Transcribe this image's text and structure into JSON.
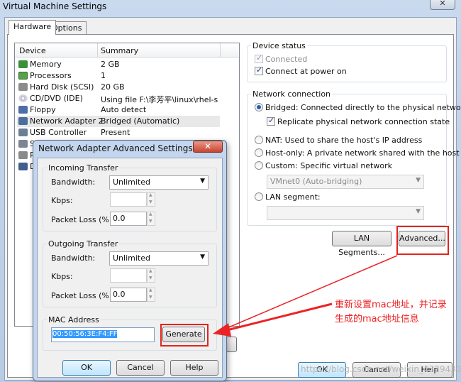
{
  "window": {
    "title": "Virtual Machine Settings",
    "close_glyph": "✕",
    "tabs": [
      {
        "label": "Hardware"
      },
      {
        "label": "Options"
      }
    ]
  },
  "devices": {
    "headers": {
      "device": "Device",
      "summary": "Summary"
    },
    "rows": [
      {
        "name": "Memory",
        "summary": "2 GB",
        "icon": "memory-icon"
      },
      {
        "name": "Processors",
        "summary": "1",
        "icon": "processor-icon"
      },
      {
        "name": "Hard Disk (SCSI)",
        "summary": "20 GB",
        "icon": "hard-disk-icon"
      },
      {
        "name": "CD/DVD (IDE)",
        "summary": "Using file F:\\李芳平\\linux\\rhel-se...",
        "icon": "cd-dvd-icon"
      },
      {
        "name": "Floppy",
        "summary": "Auto detect",
        "icon": "floppy-icon"
      },
      {
        "name": "Network Adapter 2",
        "summary": "Bridged (Automatic)",
        "icon": "network-adapter-icon",
        "selected": true
      },
      {
        "name": "USB Controller",
        "summary": "Present",
        "icon": "usb-icon"
      },
      {
        "name": "S",
        "summary": "",
        "icon": "sound-icon"
      },
      {
        "name": "P",
        "summary": "",
        "icon": "printer-icon"
      },
      {
        "name": "D",
        "summary": "",
        "icon": "display-icon"
      }
    ]
  },
  "device_status": {
    "group_label": "Device status",
    "connected": {
      "label": "Connected",
      "checked": true,
      "disabled": true
    },
    "connect_at_power_on": {
      "label": "Connect at power on",
      "checked": true
    }
  },
  "network_connection": {
    "group_label": "Network connection",
    "bridged": "Bridged: Connected directly to the physical network",
    "replicate": "Replicate physical network connection state",
    "nat": "NAT: Used to share the host's IP address",
    "host_only": "Host-only: A private network shared with the host",
    "custom": "Custom: Specific virtual network",
    "vmnet_value": "VMnet0 (Auto-bridging)",
    "lan_segment": "LAN segment:",
    "lan_segment_value": "",
    "selected": "bridged"
  },
  "buttons": {
    "lan_segments": "LAN Segments...",
    "advanced": "Advanced...",
    "ok": "OK",
    "cancel": "Cancel",
    "help": "Help"
  },
  "advanced_dialog": {
    "title": "Network Adapter Advanced Settings",
    "close_glyph": "✕",
    "incoming": {
      "group_label": "Incoming Transfer",
      "bandwidth_label": "Bandwidth:",
      "bandwidth_value": "Unlimited",
      "kbps_label": "Kbps:",
      "kbps_value": "",
      "packet_loss_label": "Packet Loss (%):",
      "packet_loss_value": "0.0"
    },
    "outgoing": {
      "group_label": "Outgoing Transfer",
      "bandwidth_label": "Bandwidth:",
      "bandwidth_value": "Unlimited",
      "kbps_label": "Kbps:",
      "kbps_value": "",
      "packet_loss_label": "Packet Loss (%):",
      "packet_loss_value": "0.0"
    },
    "mac": {
      "group_label": "MAC Address",
      "value": "00:50:56:3E:F4:FF",
      "generate_label": "Generate"
    },
    "buttons": {
      "ok": "OK",
      "cancel": "Cancel",
      "help": "Help"
    }
  },
  "annotation": {
    "line1": "重新设置mac地址，并记录",
    "line2": "生成的mac地址信息",
    "color": "#ec2325"
  },
  "watermark": {
    "text": "https://blog.csdn.net/weixin_43294304"
  }
}
